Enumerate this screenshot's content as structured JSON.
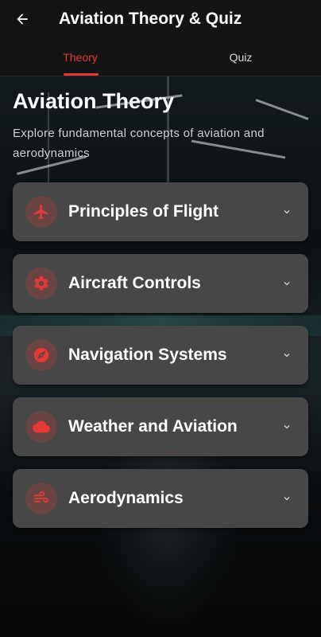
{
  "appbar": {
    "back_icon": "arrow-back-icon",
    "title": "Aviation Theory & Quiz"
  },
  "tabs": [
    {
      "label": "Theory",
      "active": true
    },
    {
      "label": "Quiz",
      "active": false
    }
  ],
  "main": {
    "heading": "Aviation Theory",
    "subtitle": "Explore fundamental concepts of aviation and aerodynamics"
  },
  "topics": [
    {
      "label": "Principles of Flight",
      "icon": "airplane-icon"
    },
    {
      "label": "Aircraft Controls",
      "icon": "gear-icon"
    },
    {
      "label": "Navigation Systems",
      "icon": "compass-icon"
    },
    {
      "label": "Weather and Aviation",
      "icon": "cloud-icon"
    },
    {
      "label": "Aerodynamics",
      "icon": "wind-icon"
    }
  ],
  "colors": {
    "accent": "#e53935",
    "card": "#474747",
    "bar": "#141414"
  }
}
